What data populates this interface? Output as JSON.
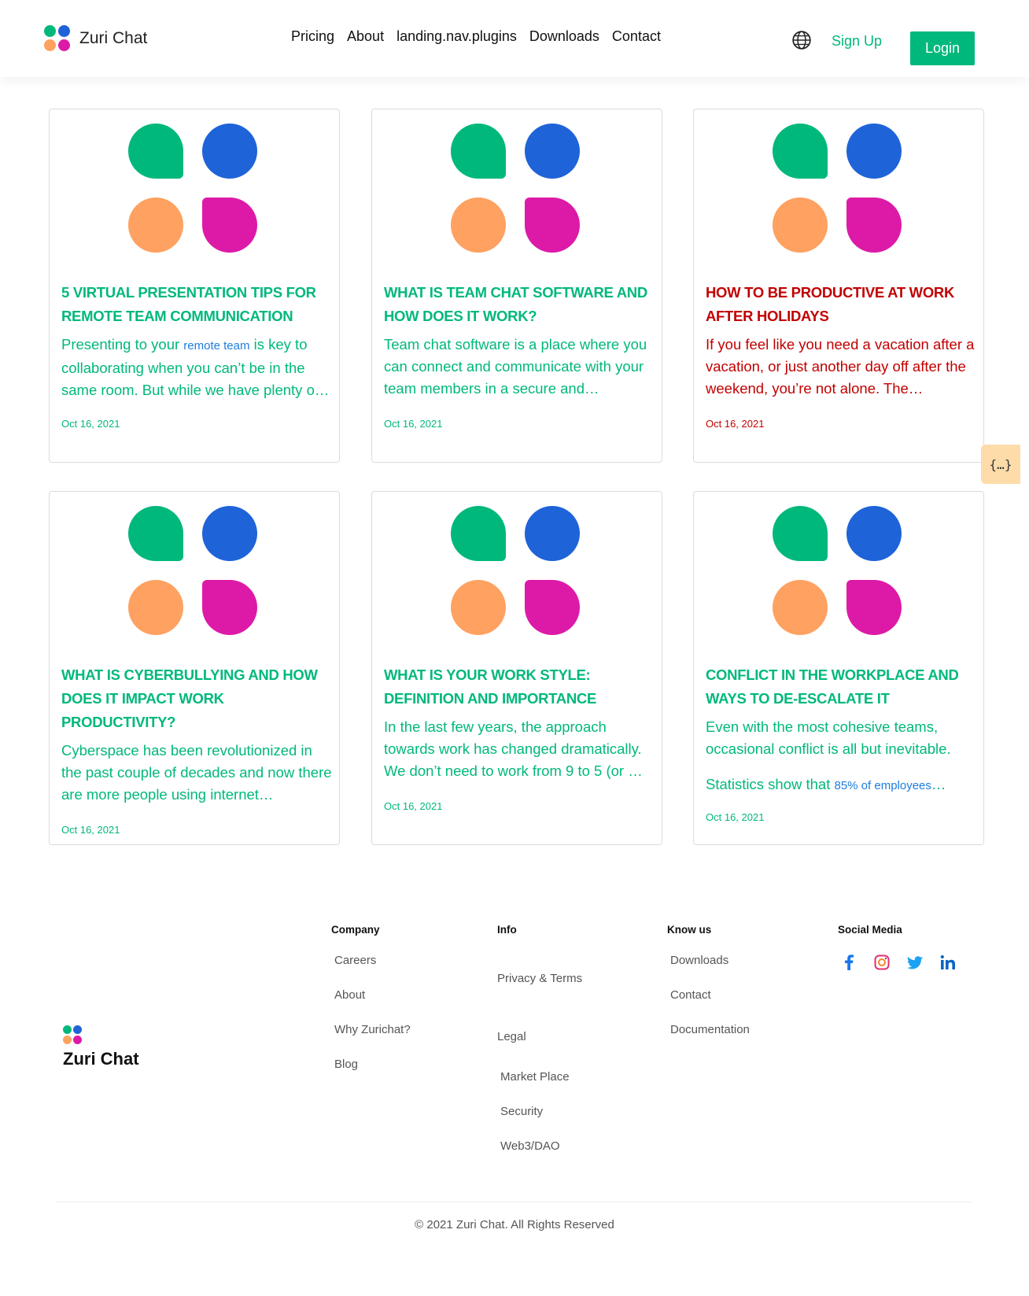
{
  "header": {
    "brand": "Zuri Chat",
    "nav": [
      "Pricing",
      "About",
      "landing.nav.plugins",
      "Downloads",
      "Contact"
    ],
    "signup": "Sign Up",
    "login": "Login"
  },
  "colors": {
    "accent": "#00b87c",
    "logo_green": "#00b87c",
    "logo_blue": "#1e63d8",
    "logo_orange": "#ffa160",
    "logo_pink": "#dd1aa8",
    "highlight_red": "#c20000"
  },
  "posts": [
    {
      "title": "5 VIRTUAL PRESENTATION TIPS FOR REMOTE TEAM COMMUNICATION",
      "excerpt_before": "Presenting to your ",
      "excerpt_link": "remote team",
      "excerpt_after": " is key to collaborating when you can’t be in the same room. But while we have plenty o…",
      "date": "Oct 16, 2021"
    },
    {
      "title": "WHAT IS TEAM CHAT SOFTWARE AND HOW DOES IT WORK?",
      "excerpt": "Team chat software is a place where you can connect and communicate with your team members in a secure and…",
      "date": "Oct 16, 2021"
    },
    {
      "title": "HOW TO BE PRODUCTIVE AT WORK AFTER HOLIDAYS",
      "excerpt": "If you feel like you need a vacation after a vacation, or just another day off after the weekend, you’re not alone. The…",
      "date": "Oct 16, 2021"
    },
    {
      "title": "WHAT IS CYBERBULLYING AND HOW DOES IT IMPACT WORK PRODUCTIVITY?",
      "excerpt": "Cyberspace has been revolutionized in the past couple of decades and now there are more people using internet…",
      "date": "Oct 16, 2021"
    },
    {
      "title": "WHAT IS YOUR WORK STYLE: DEFINITION AND IMPORTANCE",
      "excerpt": "In the last few years, the approach towards work has changed dramatically. We don’t need to work from 9 to 5 (or …",
      "date": "Oct 16, 2021"
    },
    {
      "title": "CONFLICT IN THE WORKPLACE AND WAYS TO DE-ESCALATE IT",
      "excerpt": "Even with the most cohesive teams, occasional conflict is all but inevitable.",
      "excerpt2_before": "Statistics show that ",
      "excerpt2_link": "85% of employees",
      "excerpt2_after": "…",
      "date": "Oct 16, 2021"
    }
  ],
  "side_tab": "{…}",
  "footer": {
    "brand": "Zuri Chat",
    "company": {
      "title": "Company",
      "links": [
        "Careers",
        "About",
        "Why Zurichat?",
        "Blog"
      ]
    },
    "info": {
      "title": "Info",
      "links": [
        "Privacy & Terms",
        "Legal",
        "Market Place",
        "Security",
        "Web3/DAO"
      ]
    },
    "know_us": {
      "title": "Know us",
      "links": [
        "Downloads",
        "Contact",
        "Documentation"
      ]
    },
    "social": {
      "title": "Social Media",
      "icons": [
        "facebook-icon",
        "instagram-icon",
        "twitter-icon",
        "linkedin-icon"
      ]
    },
    "copyright": "© 2021 Zuri Chat. All Rights Reserved"
  }
}
